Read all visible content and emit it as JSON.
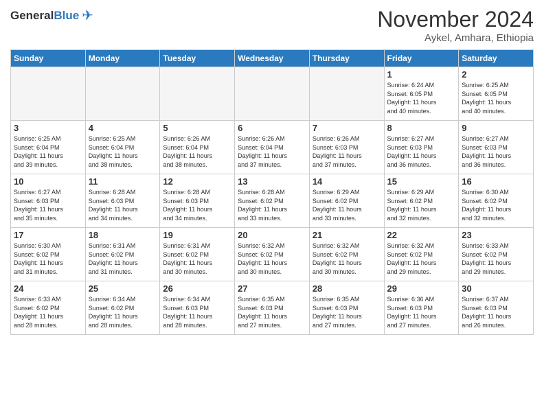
{
  "header": {
    "logo_general": "General",
    "logo_blue": "Blue",
    "month": "November 2024",
    "location": "Aykel, Amhara, Ethiopia"
  },
  "weekdays": [
    "Sunday",
    "Monday",
    "Tuesday",
    "Wednesday",
    "Thursday",
    "Friday",
    "Saturday"
  ],
  "weeks": [
    [
      {
        "day": "",
        "info": "",
        "empty": true
      },
      {
        "day": "",
        "info": "",
        "empty": true
      },
      {
        "day": "",
        "info": "",
        "empty": true
      },
      {
        "day": "",
        "info": "",
        "empty": true
      },
      {
        "day": "",
        "info": "",
        "empty": true
      },
      {
        "day": "1",
        "info": "Sunrise: 6:24 AM\nSunset: 6:05 PM\nDaylight: 11 hours\nand 40 minutes.",
        "empty": false
      },
      {
        "day": "2",
        "info": "Sunrise: 6:25 AM\nSunset: 6:05 PM\nDaylight: 11 hours\nand 40 minutes.",
        "empty": false
      }
    ],
    [
      {
        "day": "3",
        "info": "Sunrise: 6:25 AM\nSunset: 6:04 PM\nDaylight: 11 hours\nand 39 minutes.",
        "empty": false
      },
      {
        "day": "4",
        "info": "Sunrise: 6:25 AM\nSunset: 6:04 PM\nDaylight: 11 hours\nand 38 minutes.",
        "empty": false
      },
      {
        "day": "5",
        "info": "Sunrise: 6:26 AM\nSunset: 6:04 PM\nDaylight: 11 hours\nand 38 minutes.",
        "empty": false
      },
      {
        "day": "6",
        "info": "Sunrise: 6:26 AM\nSunset: 6:04 PM\nDaylight: 11 hours\nand 37 minutes.",
        "empty": false
      },
      {
        "day": "7",
        "info": "Sunrise: 6:26 AM\nSunset: 6:03 PM\nDaylight: 11 hours\nand 37 minutes.",
        "empty": false
      },
      {
        "day": "8",
        "info": "Sunrise: 6:27 AM\nSunset: 6:03 PM\nDaylight: 11 hours\nand 36 minutes.",
        "empty": false
      },
      {
        "day": "9",
        "info": "Sunrise: 6:27 AM\nSunset: 6:03 PM\nDaylight: 11 hours\nand 36 minutes.",
        "empty": false
      }
    ],
    [
      {
        "day": "10",
        "info": "Sunrise: 6:27 AM\nSunset: 6:03 PM\nDaylight: 11 hours\nand 35 minutes.",
        "empty": false
      },
      {
        "day": "11",
        "info": "Sunrise: 6:28 AM\nSunset: 6:03 PM\nDaylight: 11 hours\nand 34 minutes.",
        "empty": false
      },
      {
        "day": "12",
        "info": "Sunrise: 6:28 AM\nSunset: 6:03 PM\nDaylight: 11 hours\nand 34 minutes.",
        "empty": false
      },
      {
        "day": "13",
        "info": "Sunrise: 6:28 AM\nSunset: 6:02 PM\nDaylight: 11 hours\nand 33 minutes.",
        "empty": false
      },
      {
        "day": "14",
        "info": "Sunrise: 6:29 AM\nSunset: 6:02 PM\nDaylight: 11 hours\nand 33 minutes.",
        "empty": false
      },
      {
        "day": "15",
        "info": "Sunrise: 6:29 AM\nSunset: 6:02 PM\nDaylight: 11 hours\nand 32 minutes.",
        "empty": false
      },
      {
        "day": "16",
        "info": "Sunrise: 6:30 AM\nSunset: 6:02 PM\nDaylight: 11 hours\nand 32 minutes.",
        "empty": false
      }
    ],
    [
      {
        "day": "17",
        "info": "Sunrise: 6:30 AM\nSunset: 6:02 PM\nDaylight: 11 hours\nand 31 minutes.",
        "empty": false
      },
      {
        "day": "18",
        "info": "Sunrise: 6:31 AM\nSunset: 6:02 PM\nDaylight: 11 hours\nand 31 minutes.",
        "empty": false
      },
      {
        "day": "19",
        "info": "Sunrise: 6:31 AM\nSunset: 6:02 PM\nDaylight: 11 hours\nand 30 minutes.",
        "empty": false
      },
      {
        "day": "20",
        "info": "Sunrise: 6:32 AM\nSunset: 6:02 PM\nDaylight: 11 hours\nand 30 minutes.",
        "empty": false
      },
      {
        "day": "21",
        "info": "Sunrise: 6:32 AM\nSunset: 6:02 PM\nDaylight: 11 hours\nand 30 minutes.",
        "empty": false
      },
      {
        "day": "22",
        "info": "Sunrise: 6:32 AM\nSunset: 6:02 PM\nDaylight: 11 hours\nand 29 minutes.",
        "empty": false
      },
      {
        "day": "23",
        "info": "Sunrise: 6:33 AM\nSunset: 6:02 PM\nDaylight: 11 hours\nand 29 minutes.",
        "empty": false
      }
    ],
    [
      {
        "day": "24",
        "info": "Sunrise: 6:33 AM\nSunset: 6:02 PM\nDaylight: 11 hours\nand 28 minutes.",
        "empty": false
      },
      {
        "day": "25",
        "info": "Sunrise: 6:34 AM\nSunset: 6:02 PM\nDaylight: 11 hours\nand 28 minutes.",
        "empty": false
      },
      {
        "day": "26",
        "info": "Sunrise: 6:34 AM\nSunset: 6:03 PM\nDaylight: 11 hours\nand 28 minutes.",
        "empty": false
      },
      {
        "day": "27",
        "info": "Sunrise: 6:35 AM\nSunset: 6:03 PM\nDaylight: 11 hours\nand 27 minutes.",
        "empty": false
      },
      {
        "day": "28",
        "info": "Sunrise: 6:35 AM\nSunset: 6:03 PM\nDaylight: 11 hours\nand 27 minutes.",
        "empty": false
      },
      {
        "day": "29",
        "info": "Sunrise: 6:36 AM\nSunset: 6:03 PM\nDaylight: 11 hours\nand 27 minutes.",
        "empty": false
      },
      {
        "day": "30",
        "info": "Sunrise: 6:37 AM\nSunset: 6:03 PM\nDaylight: 11 hours\nand 26 minutes.",
        "empty": false
      }
    ]
  ]
}
